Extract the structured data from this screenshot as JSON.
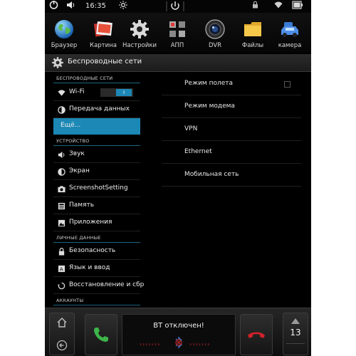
{
  "status_bar": {
    "time": "16:35"
  },
  "launcher": {
    "apps": [
      {
        "label": "Браузер",
        "icon": "globe-icon"
      },
      {
        "label": "Картина",
        "icon": "picture-icon"
      },
      {
        "label": "Настройки",
        "icon": "gear-icon"
      },
      {
        "label": "АПП",
        "icon": "apps-grid-icon"
      },
      {
        "label": "DVR",
        "icon": "camera-lens-icon"
      },
      {
        "label": "Файлы",
        "icon": "folder-icon"
      },
      {
        "label": "камера",
        "icon": "car-camera-icon"
      }
    ]
  },
  "title_bar": {
    "title": "Беспроводные сети"
  },
  "settings": {
    "sections": [
      {
        "header": "БЕСПРОВОДНЫЕ СЕТИ"
      },
      {
        "header": "УСТРОЙСТВО"
      },
      {
        "header": "ЛИЧНЫЕ ДАННЫЕ"
      },
      {
        "header": "АККАУНТЫ"
      }
    ],
    "items": [
      {
        "label": "Wi-Fi",
        "icon": "wifi-icon"
      },
      {
        "label": "Передача данных",
        "icon": "data-usage-icon"
      },
      {
        "label": "Ещё...",
        "selected": true
      },
      {
        "label": "Звук",
        "icon": "speaker-icon"
      },
      {
        "label": "Экран",
        "icon": "brightness-icon"
      },
      {
        "label": "ScreenshotSetting",
        "icon": "camera-icon"
      },
      {
        "label": "Память",
        "icon": "storage-icon"
      },
      {
        "label": "Приложения",
        "icon": "apps-icon"
      },
      {
        "label": "Безопасность",
        "icon": "lock-icon"
      },
      {
        "label": "Язык и ввод",
        "icon": "language-icon"
      },
      {
        "label": "Восстановление и сбр",
        "icon": "restore-icon"
      }
    ],
    "wifi_toggle_state": "I"
  },
  "more_pane": {
    "items": [
      {
        "label": "Режим полета"
      },
      {
        "label": "Режим модема"
      },
      {
        "label": "VPN"
      },
      {
        "label": "Ethernet"
      },
      {
        "label": "Мобильная сеть"
      }
    ]
  },
  "bottom_bar": {
    "bt_message": "BT отключен!",
    "bt_arrows_left": "›››››››",
    "bt_arrows_right": "›››››››",
    "volume": "13"
  },
  "colors": {
    "accent": "#1c88b6",
    "call_green": "#3db54a",
    "call_red": "#d0222a",
    "bt_red": "#c0272d"
  }
}
